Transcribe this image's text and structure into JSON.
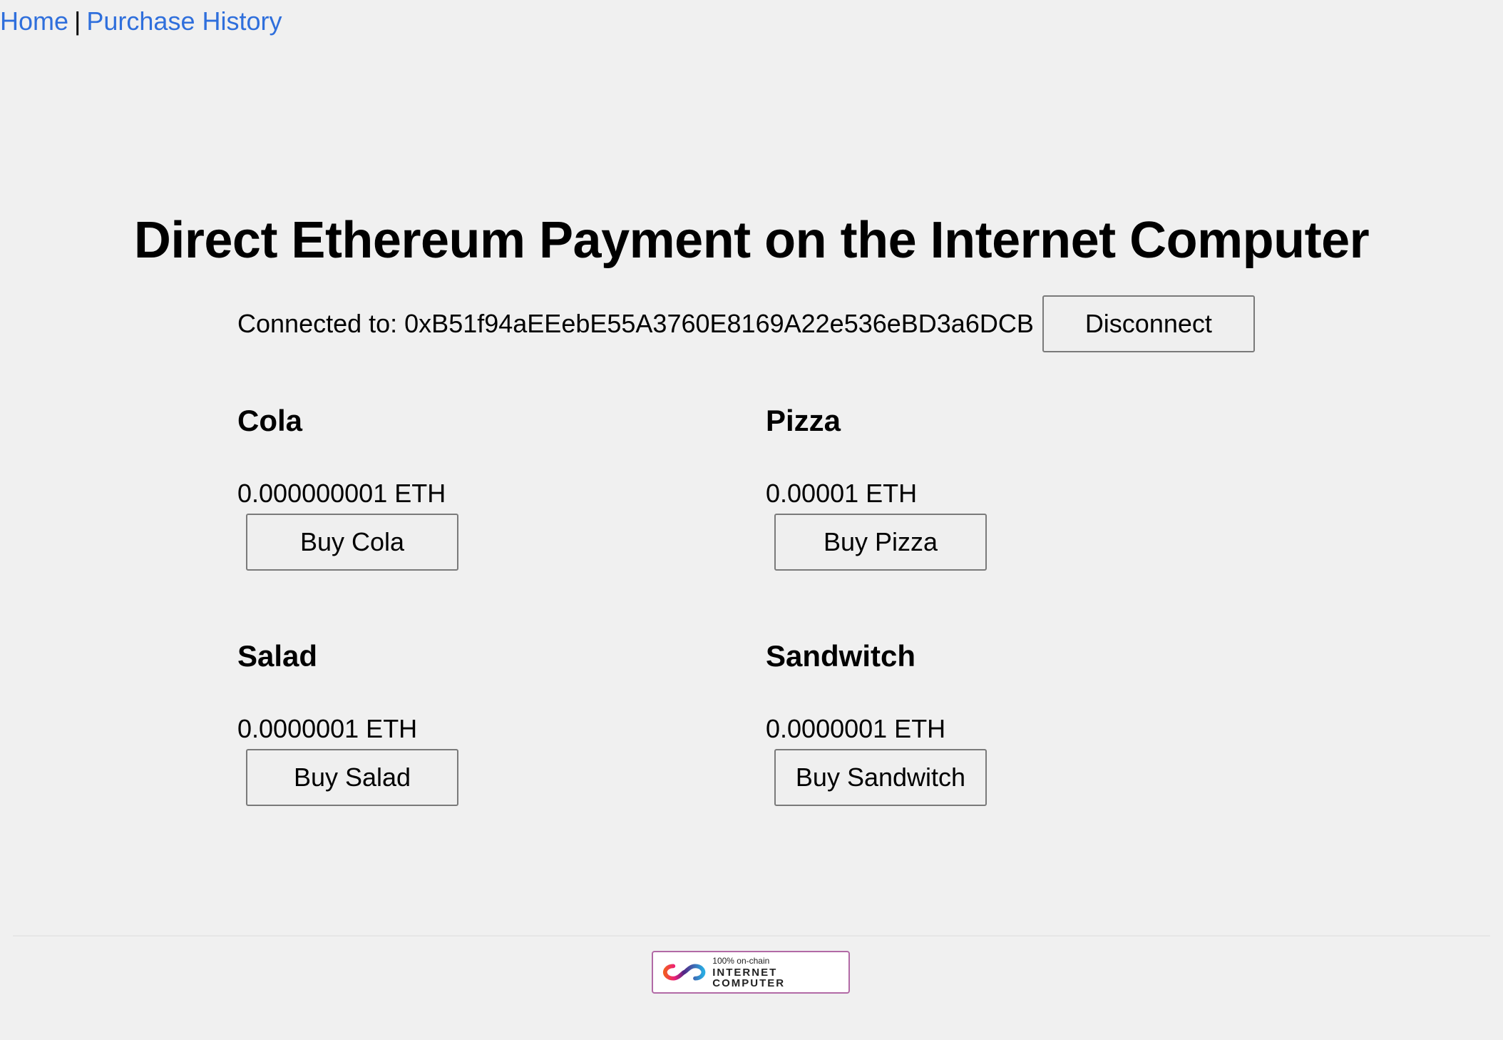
{
  "nav": {
    "home_label": "Home",
    "separator": "|",
    "history_label": "Purchase History"
  },
  "header": {
    "title": "Direct Ethereum Payment on the Internet Computer"
  },
  "wallet": {
    "connected_label": "Connected to:",
    "address": "0xB51f94aEEebE55A3760E8169A22e536eBD3a6DCB",
    "disconnect_label": "Disconnect"
  },
  "products": [
    {
      "name": "Cola",
      "price": "0.000000001 ETH",
      "button_label": "Buy Cola"
    },
    {
      "name": "Pizza",
      "price": "0.00001 ETH",
      "button_label": "Buy Pizza"
    },
    {
      "name": "Salad",
      "price": "0.0000001 ETH",
      "button_label": "Buy Salad"
    },
    {
      "name": "Sandwitch",
      "price": "0.0000001 ETH",
      "button_label": "Buy Sandwitch"
    }
  ],
  "footer": {
    "badge_small": "100% on-chain",
    "badge_big": "INTERNET COMPUTER",
    "badge_icon": "infinity-icon",
    "badge_border_color": "#b26aa6"
  },
  "colors": {
    "link": "#2f6fdc",
    "background": "#f0f0f0"
  }
}
